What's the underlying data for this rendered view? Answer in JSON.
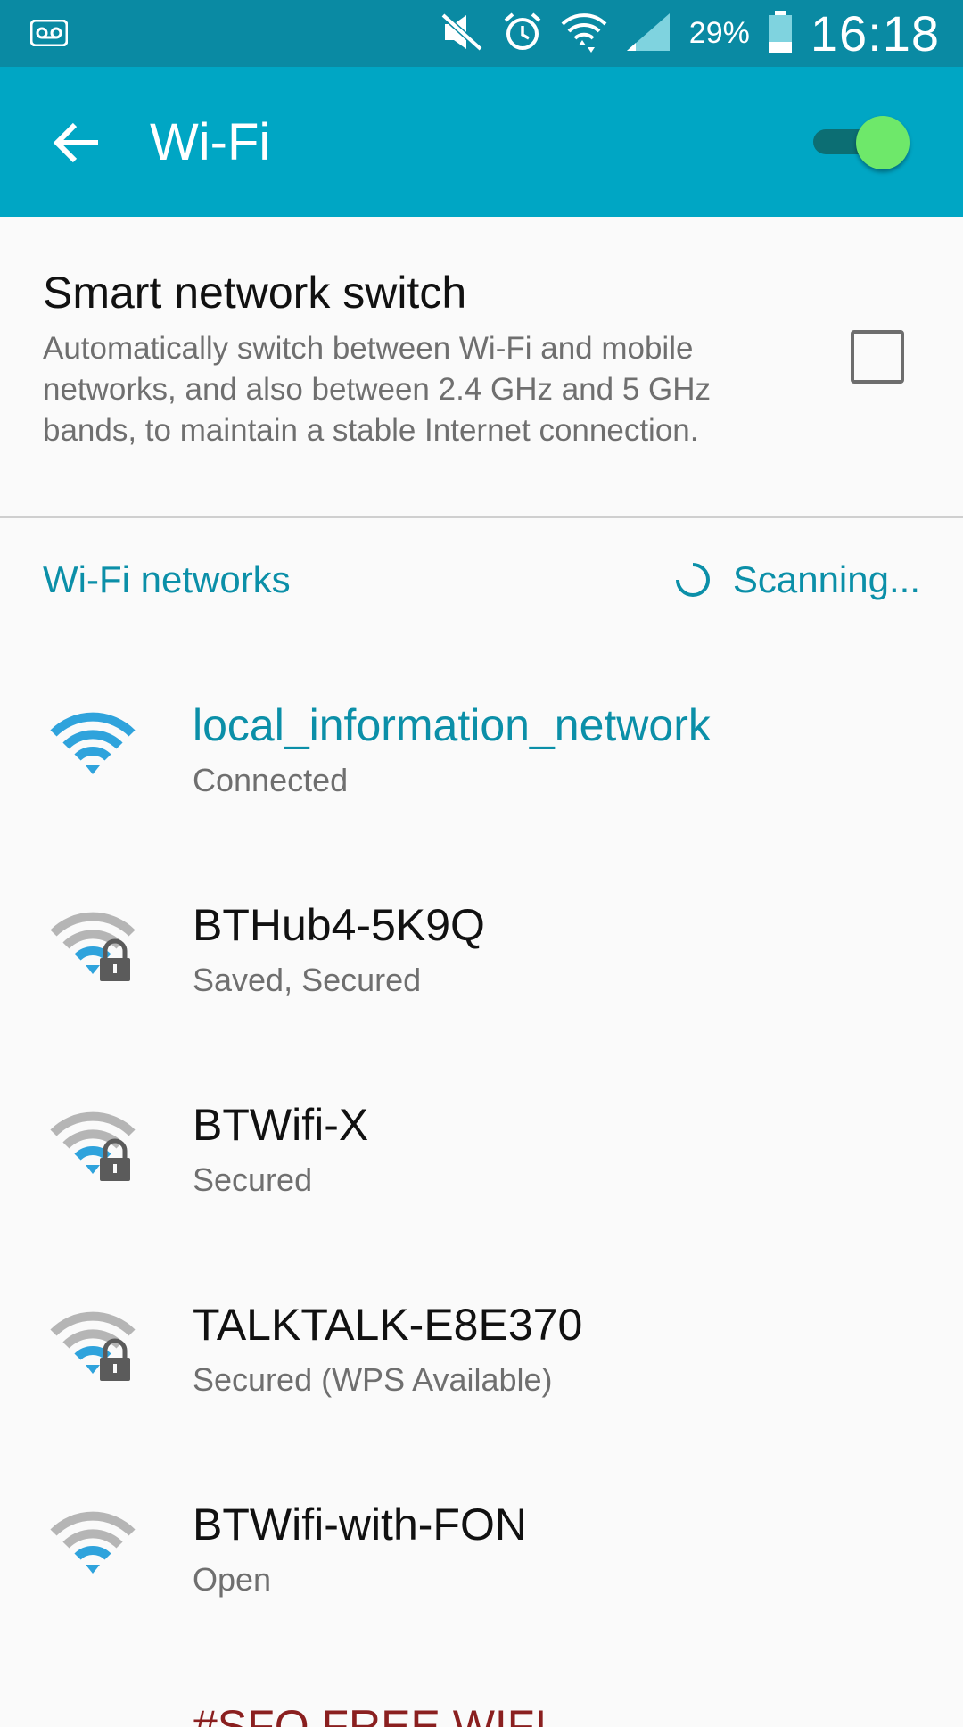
{
  "status_bar": {
    "voicemail_icon": "voicemail-icon",
    "mute_icon": "mute-icon",
    "alarm_icon": "alarm-icon",
    "wifi_icon": "wifi-data-icon",
    "signal_icon": "signal-icon",
    "battery_percent": "29%",
    "battery_level": 0.29,
    "time": "16:18"
  },
  "app_bar": {
    "title": "Wi-Fi",
    "back_icon": "back-arrow-icon",
    "wifi_enabled": true,
    "accent_color": "#00a6c4"
  },
  "smart_network_switch": {
    "title": "Smart network switch",
    "description": "Automatically switch between Wi-Fi and mobile networks, and also between 2.4 GHz and 5 GHz bands, to maintain a stable Internet connection.",
    "checked": false
  },
  "networks_section": {
    "title": "Wi-Fi networks",
    "status": "Scanning..."
  },
  "networks": [
    {
      "name": "local_information_network",
      "status": "Connected",
      "connected": true,
      "secured": false,
      "icon": "wifi-connected-icon"
    },
    {
      "name": "BTHub4-5K9Q",
      "status": "Saved, Secured",
      "connected": false,
      "secured": true,
      "icon": "wifi-locked-icon"
    },
    {
      "name": "BTWifi-X",
      "status": "Secured",
      "connected": false,
      "secured": true,
      "icon": "wifi-locked-icon"
    },
    {
      "name": "TALKTALK-E8E370",
      "status": "Secured (WPS Available)",
      "connected": false,
      "secured": true,
      "icon": "wifi-locked-icon"
    },
    {
      "name": "BTWifi-with-FON",
      "status": "Open",
      "connected": false,
      "secured": false,
      "icon": "wifi-open-icon"
    }
  ],
  "partial_network": {
    "name": "#SFO FREE WIFI"
  }
}
